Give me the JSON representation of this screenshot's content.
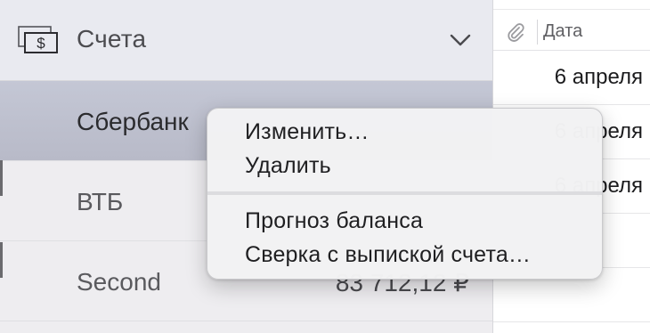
{
  "sidebar": {
    "section_title": "Счета",
    "icon": "money-dollar-icon",
    "chevron": "chevron-down-icon",
    "accounts": [
      {
        "name": "Сбербанк",
        "balance": "",
        "selected": true
      },
      {
        "name": "ВТБ",
        "balance": ""
      },
      {
        "name": "Second",
        "balance": "83 712,12 ₽"
      }
    ]
  },
  "table": {
    "attachment_icon": "paperclip-icon",
    "date_header": "Дата",
    "rows": [
      {
        "date": "6 апреля"
      },
      {
        "date": "6 апреля"
      },
      {
        "date": "6 апреля"
      },
      {
        "date": ""
      },
      {
        "date": ""
      }
    ]
  },
  "context_menu": {
    "items": [
      {
        "label": "Изменить…"
      },
      {
        "label": "Удалить"
      },
      {
        "label": "Прогноз баланса"
      },
      {
        "label": "Сверка с выпиской счета…"
      }
    ]
  },
  "colors": {
    "selected_row": "#bfc2d0",
    "sidebar_bg": "#eeedf0",
    "menu_bg": "#f2f2f3"
  }
}
